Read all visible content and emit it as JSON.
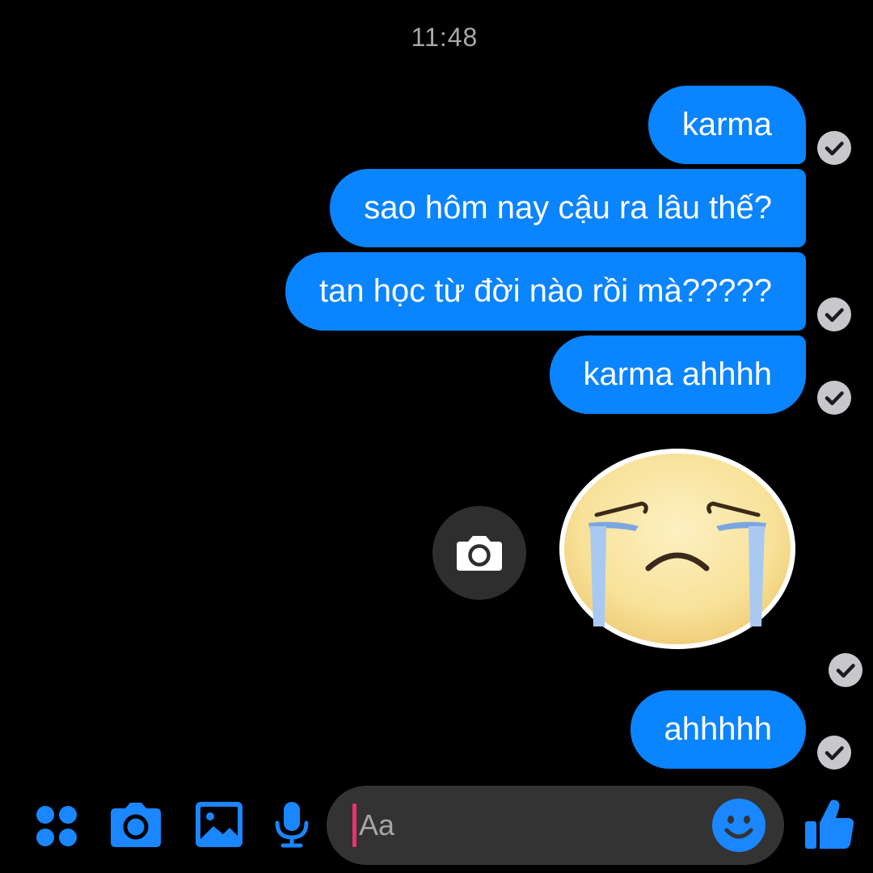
{
  "thread": {
    "timestamp": "11:48",
    "messages": [
      {
        "text": "karma",
        "status": "delivered"
      },
      {
        "text": "sao hôm nay cậu ra lâu thế?",
        "status": "none"
      },
      {
        "text": "tan học từ đời nào rồi mà?????",
        "status": "delivered"
      },
      {
        "text": "karma ahhhh",
        "status": "delivered"
      },
      {
        "sticker": "crying-face-sticker",
        "status": "delivered"
      },
      {
        "text": "ahhhhh",
        "status": "delivered"
      }
    ]
  },
  "composer": {
    "placeholder": "Aa"
  },
  "toolbar": {
    "icons": [
      "apps-icon",
      "camera-icon",
      "gallery-icon",
      "microphone-icon",
      "emoji-icon",
      "thumbs-up-icon"
    ]
  },
  "colors": {
    "background": "#000000",
    "bubble": "#0a84ff",
    "accent": "#1a86ff",
    "caret": "#e8336d",
    "composer": "#333333"
  }
}
